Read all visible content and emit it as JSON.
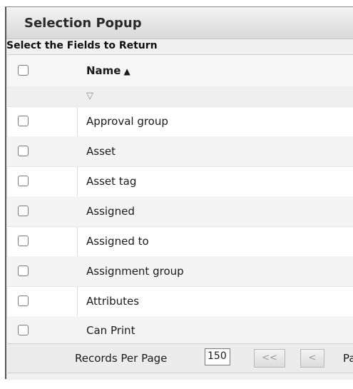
{
  "popup": {
    "title": "Selection Popup",
    "subtitle": "Select the Fields to Return"
  },
  "table": {
    "header": {
      "name_label": "Name",
      "sort_icon": "▲"
    },
    "filter_icon": "▽",
    "rows": [
      {
        "label": "Approval group"
      },
      {
        "label": "Asset"
      },
      {
        "label": "Asset tag"
      },
      {
        "label": "Assigned"
      },
      {
        "label": "Assigned to"
      },
      {
        "label": "Assignment group"
      },
      {
        "label": "Attributes"
      },
      {
        "label": "Can Print"
      }
    ]
  },
  "pager": {
    "records_per_page_label": "Records Per Page",
    "records_per_page_value": "150",
    "first_label": "<<",
    "prev_label": "<",
    "page_label": "Pa"
  }
}
